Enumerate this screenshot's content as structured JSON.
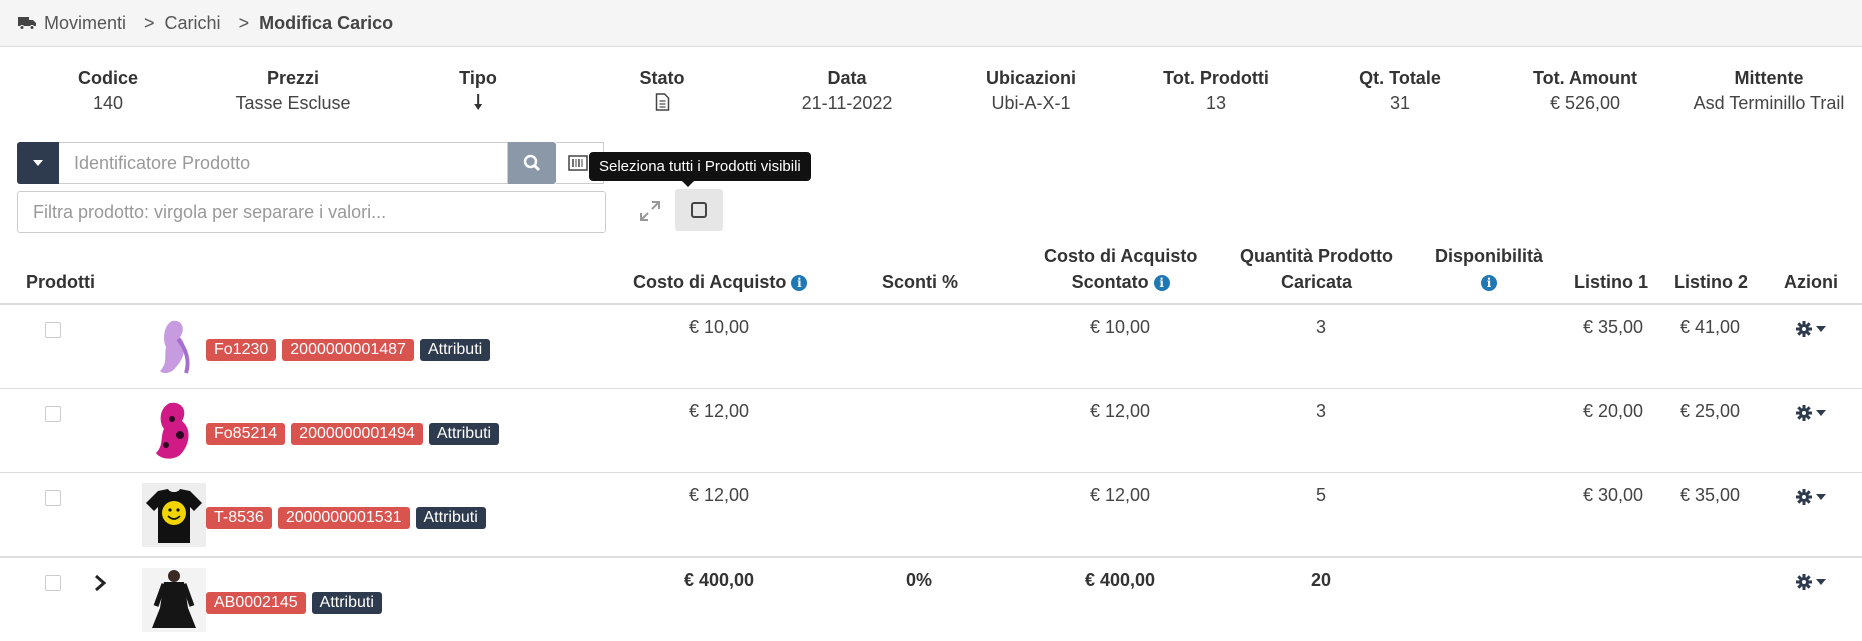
{
  "breadcrumb": {
    "item1": "Movimenti",
    "item2": "Carichi",
    "item3": "Modifica Carico",
    "separator": ">"
  },
  "summary": [
    {
      "label": "Codice",
      "value": "140"
    },
    {
      "label": "Prezzi",
      "value": "Tasse Escluse"
    },
    {
      "label": "Tipo",
      "value": ""
    },
    {
      "label": "Stato",
      "value": ""
    },
    {
      "label": "Data",
      "value": "21-11-2022"
    },
    {
      "label": "Ubicazioni",
      "value": "Ubi-A-X-1"
    },
    {
      "label": "Tot. Prodotti",
      "value": "13"
    },
    {
      "label": "Qt. Totale",
      "value": "31"
    },
    {
      "label": "Tot. Amount",
      "value": "€ 526,00"
    },
    {
      "label": "Mittente",
      "value": "Asd Terminillo Trail"
    }
  ],
  "toolbar": {
    "search_placeholder": "Identificatore Prodotto",
    "filter_placeholder": "Filtra prodotto: virgola per separare i valori...",
    "tooltip": "Seleziona tutti i Prodotti visibili"
  },
  "table": {
    "headers": {
      "prodotti": "Prodotti",
      "costo": "Costo di Acquisto",
      "sconti": "Sconti %",
      "scontato_1": "Costo di Acquisto",
      "scontato_2": "Scontato",
      "qty_1": "Quantità Prodotto",
      "qty_2": "Caricata",
      "disp": "Disponibilità",
      "l1": "Listino 1",
      "l2": "Listino 2",
      "azioni": "Azioni"
    },
    "rows": [
      {
        "code": "Fo1230",
        "ean": "2000000001487",
        "attr": "Attributi",
        "costo": "€ 10,00",
        "scontato": "€ 10,00",
        "qty": "3",
        "l1": "€ 35,00",
        "l2": "€ 41,00"
      },
      {
        "code": "Fo85214",
        "ean": "2000000001494",
        "attr": "Attributi",
        "costo": "€ 12,00",
        "scontato": "€ 12,00",
        "qty": "3",
        "l1": "€ 20,00",
        "l2": "€ 25,00"
      },
      {
        "code": "T-8536",
        "ean": "2000000001531",
        "attr": "Attributi",
        "costo": "€ 12,00",
        "scontato": "€ 12,00",
        "qty": "5",
        "l1": "€ 30,00",
        "l2": "€ 35,00"
      }
    ],
    "total": {
      "code": "AB0002145",
      "attr": "Attributi",
      "costo": "€ 400,00",
      "sconti": "0%",
      "scontato": "€ 400,00",
      "qty": "20"
    }
  },
  "colors": {
    "dark": "#2e3b4e",
    "badge_red": "#d9534f",
    "info": "#1f78b4"
  }
}
